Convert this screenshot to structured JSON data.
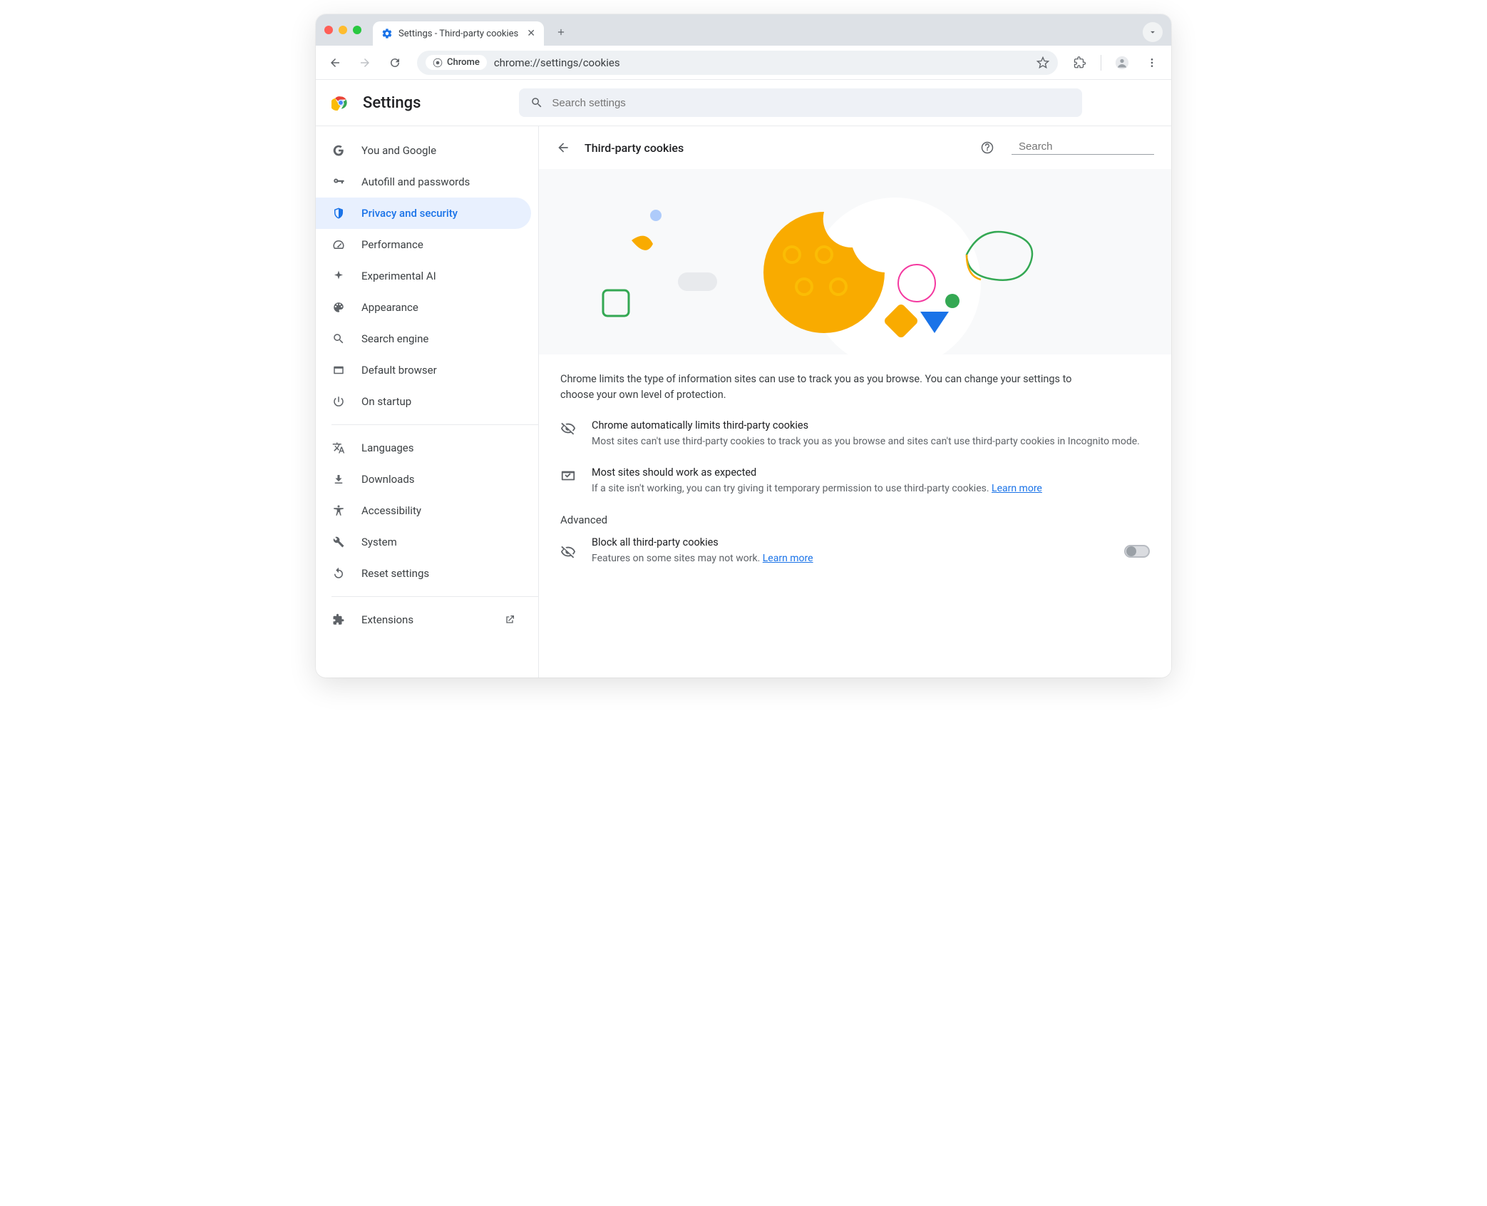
{
  "window": {
    "tab_title": "Settings - Third-party cookies",
    "url_label": "Chrome",
    "url": "chrome://settings/cookies"
  },
  "header": {
    "title": "Settings",
    "search_placeholder": "Search settings"
  },
  "sidebar": {
    "items": [
      {
        "label": "You and Google"
      },
      {
        "label": "Autofill and passwords"
      },
      {
        "label": "Privacy and security"
      },
      {
        "label": "Performance"
      },
      {
        "label": "Experimental AI"
      },
      {
        "label": "Appearance"
      },
      {
        "label": "Search engine"
      },
      {
        "label": "Default browser"
      },
      {
        "label": "On startup"
      }
    ],
    "items2": [
      {
        "label": "Languages"
      },
      {
        "label": "Downloads"
      },
      {
        "label": "Accessibility"
      },
      {
        "label": "System"
      },
      {
        "label": "Reset settings"
      }
    ],
    "extensions": "Extensions"
  },
  "main": {
    "title": "Third-party cookies",
    "search_placeholder": "Search",
    "intro": "Chrome limits the type of information sites can use to track you as you browse. You can change your settings to choose your own level of protection.",
    "info1_title": "Chrome automatically limits third-party cookies",
    "info1_desc": "Most sites can't use third-party cookies to track you as you browse and sites can't use third-party cookies in Incognito mode.",
    "info2_title": "Most sites should work as expected",
    "info2_desc": "If a site isn't working, you can try giving it temporary permission to use third-party cookies. ",
    "learn_more": "Learn more",
    "advanced": "Advanced",
    "block_title": "Block all third-party cookies",
    "block_desc": "Features on some sites may not work. "
  }
}
